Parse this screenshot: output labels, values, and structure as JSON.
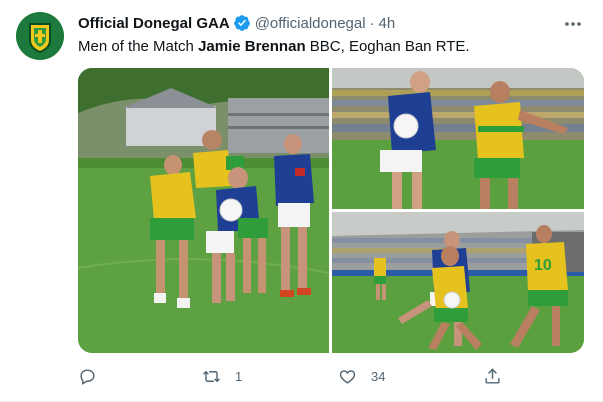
{
  "tweet": {
    "display_name": "Official Donegal GAA",
    "handle": "@officialdonegal",
    "separator": "·",
    "time": "4h",
    "text_prefix": "Men of the Match ",
    "text_bold": "Jamie Brennan",
    "text_suffix": " BBC, Eoghan Ban RTE.",
    "media": [
      {
        "name": "photo-tackle-group"
      },
      {
        "name": "photo-player-chase"
      },
      {
        "name": "photo-player-kick"
      }
    ]
  },
  "actions": {
    "reply_icon": "reply-icon",
    "retweet_icon": "retweet-icon",
    "retweet_count": "1",
    "like_icon": "like-icon",
    "like_count": "34",
    "share_icon": "share-icon"
  },
  "colors": {
    "verified": "#1d9bf0",
    "secondary_text": "#536471",
    "donegal_yellow": "#e6c21e",
    "donegal_green": "#2f9e3a",
    "cavan_blue": "#1f3f95",
    "pitch_green": "#4c9c3a"
  }
}
